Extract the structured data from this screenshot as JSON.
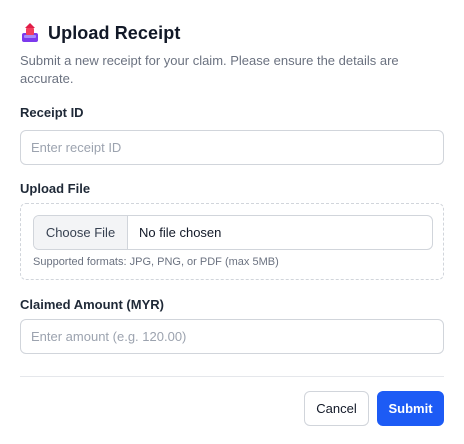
{
  "header": {
    "icon": "inbox-tray-upload-icon",
    "title": "Upload Receipt",
    "subtitle": "Submit a new receipt for your claim. Please ensure the details are accurate."
  },
  "fields": {
    "receipt_id": {
      "label": "Receipt ID",
      "placeholder": "Enter receipt ID",
      "value": ""
    },
    "upload_file": {
      "label": "Upload File",
      "button_label": "Choose File",
      "file_name": "No file chosen",
      "hint": "Supported formats: JPG, PNG, or PDF (max 5MB)"
    },
    "claimed_amount": {
      "label": "Claimed Amount (MYR)",
      "placeholder": "Enter amount (e.g. 120.00)",
      "value": ""
    }
  },
  "actions": {
    "cancel_label": "Cancel",
    "submit_label": "Submit"
  },
  "colors": {
    "accent": "#1d5bf5",
    "border": "#d1d5db",
    "muted_text": "#6b7280"
  }
}
